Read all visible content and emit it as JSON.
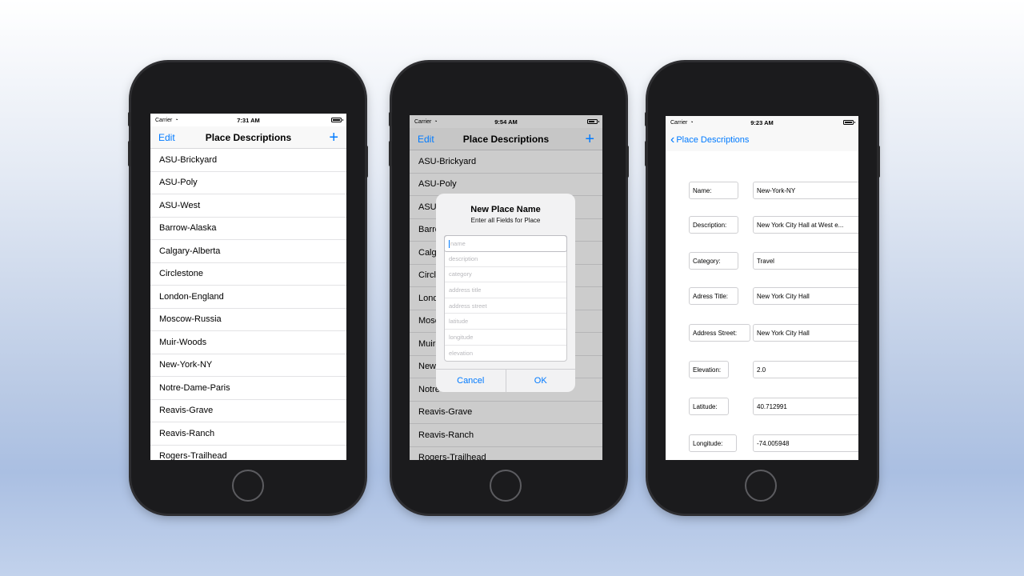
{
  "phone1": {
    "status": {
      "carrier": "Carrier",
      "time": "7:31 AM"
    },
    "nav": {
      "left": "Edit",
      "title": "Place Descriptions",
      "right": "+"
    },
    "places": [
      "ASU-Brickyard",
      "ASU-Poly",
      "ASU-West",
      "Barrow-Alaska",
      "Calgary-Alberta",
      "Circlestone",
      "London-England",
      "Moscow-Russia",
      "Muir-Woods",
      "New-York-NY",
      "Notre-Dame-Paris",
      "Reavis-Grave",
      "Reavis-Ranch",
      "Rogers-Trailhead"
    ]
  },
  "phone2": {
    "status": {
      "carrier": "Carrier",
      "time": "9:54 AM"
    },
    "nav": {
      "left": "Edit",
      "title": "Place Descriptions",
      "right": "+"
    },
    "places": [
      "ASU-Brickyard",
      "ASU-Poly",
      "ASU-",
      "Barro",
      "Calga",
      "Circl",
      "Londo",
      "Mosc",
      "Muir-",
      "New-",
      "Notre",
      "Reavis-Grave",
      "Reavis-Ranch",
      "Rogers-Trailhead"
    ],
    "alert": {
      "title": "New Place Name",
      "message": "Enter all Fields for Place",
      "placeholders": [
        "name",
        "description",
        "category",
        "address title",
        "address street",
        "latitude",
        "longitude",
        "elevation"
      ],
      "cancel": "Cancel",
      "ok": "OK"
    }
  },
  "phone3": {
    "status": {
      "carrier": "Carrier",
      "time": "9:23 AM"
    },
    "back": "Place Descriptions",
    "fields": [
      {
        "label": "Name:",
        "value": "New-York-NY"
      },
      {
        "label": "Description:",
        "value": "New York City Hall at West e..."
      },
      {
        "label": "Category:",
        "value": "Travel"
      },
      {
        "label": "Adress Title:",
        "value": "New York City Hall"
      },
      {
        "label": "Address Street:",
        "value": "New York City Hall"
      },
      {
        "label": "Elevation:",
        "value": "2.0"
      },
      {
        "label": "Latitude:",
        "value": "40.712991"
      },
      {
        "label": "Longitude:",
        "value": "-74.005948"
      }
    ]
  },
  "colors": {
    "accent": "#007aff",
    "phone_body": "#1b1b1d"
  }
}
